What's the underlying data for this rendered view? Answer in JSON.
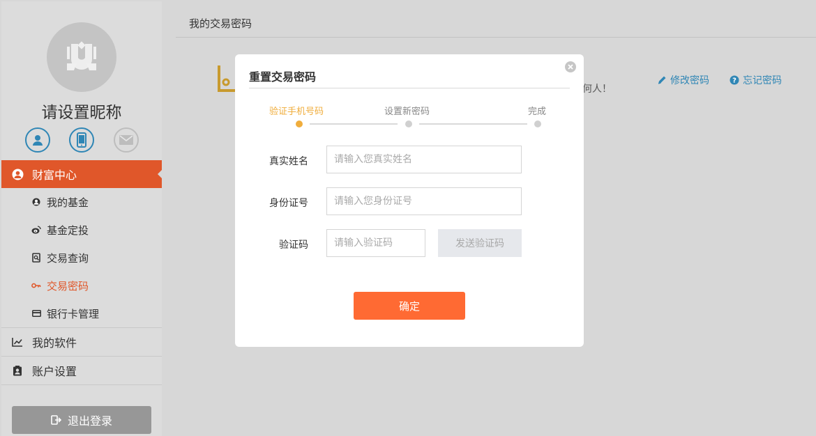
{
  "sidebar": {
    "nickname": "请设置昵称",
    "verify_icons": [
      "user-verify-icon",
      "phone-verify-icon",
      "mail-verify-icon"
    ],
    "wealth_center": "财富中心",
    "sub_items": [
      {
        "label": "我的基金",
        "icon": "user-circle-icon"
      },
      {
        "label": "基金定投",
        "icon": "weibo-icon"
      },
      {
        "label": "交易查询",
        "icon": "search-doc-icon"
      },
      {
        "label": "交易密码",
        "icon": "key-icon",
        "active": true
      },
      {
        "label": "银行卡管理",
        "icon": "credit-card-icon"
      }
    ],
    "my_software": "我的软件",
    "account_settings": "账户设置",
    "logout": "退出登录",
    "accent_color": "#e0572a"
  },
  "content": {
    "title": "我的交易密码",
    "bg_text": "何人！",
    "modify_link": "修改密码",
    "forgot_link": "忘记密码",
    "link_color": "#2f86b5"
  },
  "modal": {
    "title": "重置交易密码",
    "steps": [
      {
        "label": "验证手机号码",
        "active": true
      },
      {
        "label": "设置新密码",
        "active": false
      },
      {
        "label": "完成",
        "active": false
      }
    ],
    "fields": {
      "name_label": "真实姓名",
      "name_placeholder": "请输入您真实姓名",
      "id_label": "身份证号",
      "id_placeholder": "请输入您身份证号",
      "code_label": "验证码",
      "code_placeholder": "请输入验证码"
    },
    "send_code": "发送验证码",
    "confirm": "确定",
    "step_color": "#f0ad3c",
    "button_color": "#ff6a33"
  }
}
